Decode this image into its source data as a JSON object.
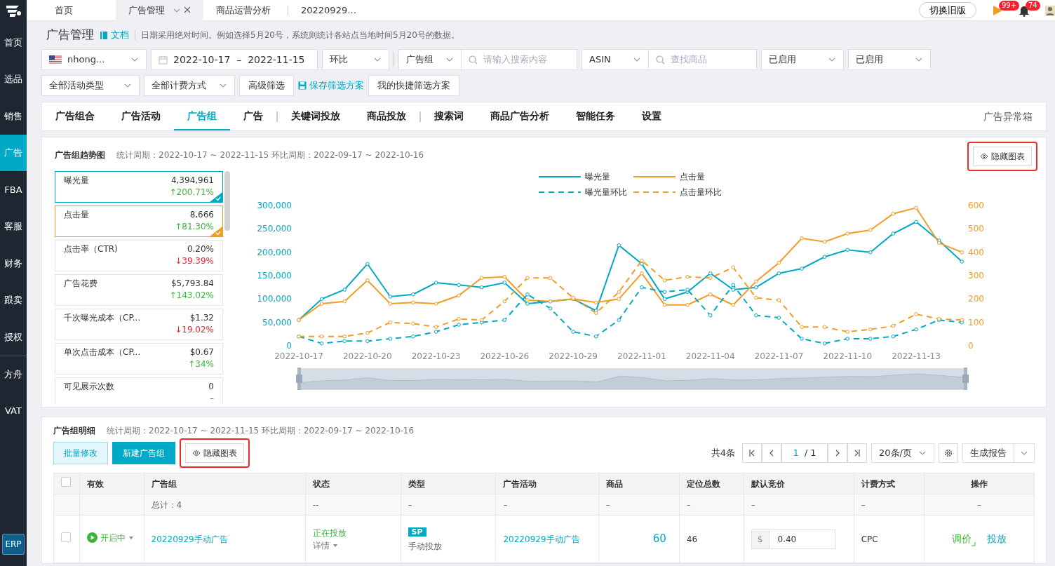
{
  "sidebar": {
    "items": [
      {
        "label": "首页",
        "selected": false,
        "divider_before": false
      },
      {
        "label": "选品",
        "selected": false,
        "divider_before": false
      },
      {
        "label": "销售",
        "selected": false,
        "divider_before": false
      },
      {
        "label": "广告",
        "selected": true,
        "divider_before": false
      },
      {
        "label": "FBA",
        "selected": false,
        "divider_before": false
      },
      {
        "label": "客服",
        "selected": false,
        "divider_before": false
      },
      {
        "label": "财务",
        "selected": false,
        "divider_before": false
      },
      {
        "label": "跟卖",
        "selected": false,
        "divider_before": false
      },
      {
        "label": "授权",
        "selected": false,
        "divider_before": false
      },
      {
        "label": "方舟",
        "selected": false,
        "divider_before": true
      },
      {
        "label": "VAT",
        "selected": false,
        "divider_before": false
      }
    ],
    "footer": "ERP"
  },
  "top_tabs": [
    {
      "label": "首页",
      "selected": false,
      "closable": false
    },
    {
      "label": "广告管理",
      "selected": true,
      "closable": true
    },
    {
      "label": "商品运营分析",
      "selected": false,
      "closable": false
    },
    {
      "label": "20220929…",
      "selected": false,
      "closable": false
    }
  ],
  "header_actions": {
    "switch_button": "切换旧版",
    "flag_badge": "99+",
    "bell_badge": "74"
  },
  "page": {
    "title": "广告管理",
    "doc_link": "文档",
    "note": "日期采用绝对时间。例如选择5月20号，系统则统计各站点当地时间5月20号的数据。"
  },
  "filters": {
    "row1": [
      {
        "kind": "store",
        "value": "nhong..."
      },
      {
        "kind": "daterange",
        "start": "2022-10-17",
        "separator": "–",
        "end": "2022-11-15"
      },
      {
        "kind": "select",
        "value": "环比"
      },
      {
        "kind": "combo",
        "select": "广告组",
        "placeholder": "请输入搜索内容",
        "divider_before": true
      },
      {
        "kind": "combo",
        "select": "ASIN",
        "placeholder": "查找商品",
        "divider_before": false
      },
      {
        "kind": "select",
        "value": "已启用"
      },
      {
        "kind": "select",
        "value": "已启用"
      }
    ],
    "row2": [
      {
        "kind": "select",
        "value": "全部活动类型"
      },
      {
        "kind": "select",
        "value": "全部计费方式"
      },
      {
        "kind": "button",
        "label": "高级筛选"
      },
      {
        "kind": "link",
        "label": "保存筛选方案"
      },
      {
        "kind": "button",
        "label": "我的快捷筛选方案"
      }
    ]
  },
  "nav_tabs": {
    "items": [
      {
        "label": "广告组合",
        "selected": false,
        "divider_after": false
      },
      {
        "label": "广告活动",
        "selected": false,
        "divider_after": false
      },
      {
        "label": "广告组",
        "selected": true,
        "divider_after": false
      },
      {
        "label": "广告",
        "selected": false,
        "divider_after": true
      },
      {
        "label": "关键词投放",
        "selected": false,
        "divider_after": false
      },
      {
        "label": "商品投放",
        "selected": false,
        "divider_after": true
      },
      {
        "label": "搜索词",
        "selected": false,
        "divider_after": false
      },
      {
        "label": "商品广告分析",
        "selected": false,
        "divider_after": false
      },
      {
        "label": "智能任务",
        "selected": false,
        "divider_after": false
      },
      {
        "label": "设置",
        "selected": false,
        "divider_after": false
      }
    ],
    "right_link": "广告异常箱"
  },
  "trend": {
    "title": "广告组趋势图",
    "period": "统计周期：2022-10-17 ~ 2022-11-15 环比周期：2022-09-17 ~ 2022-10-16",
    "hide_button": "隐藏图表",
    "highlighted": true,
    "metrics": [
      {
        "name": "曝光量",
        "value": "4,394,961",
        "change": "↑200.71%",
        "rising": true,
        "selected": true,
        "color": "#00a9c5"
      },
      {
        "name": "点击量",
        "value": "8,666",
        "change": "↑81.30%",
        "rising": true,
        "selected": true,
        "color": "#f39c25"
      },
      {
        "name": "点击率（CTR)",
        "value": "0.20%",
        "change": "↓39.39%",
        "rising": false,
        "selected": false
      },
      {
        "name": "广告花费",
        "value": "$5,793.84",
        "change": "↑143.02%",
        "rising": true,
        "selected": false
      },
      {
        "name": "千次曝光成本（CP...",
        "value": "$1.32",
        "change": "↓19.02%",
        "rising": false,
        "selected": false
      },
      {
        "name": "单次点击成本（CP...",
        "value": "$0.67",
        "change": "↑34%",
        "rising": true,
        "selected": false
      },
      {
        "name": "可见展示次数",
        "value": "0",
        "change": "–",
        "selected": false
      }
    ],
    "chart_data": {
      "type": "line",
      "legend": "top",
      "categories": [
        "2022-10-17",
        null,
        null,
        "2022-10-20",
        null,
        null,
        "2022-10-23",
        null,
        null,
        "2022-10-26",
        null,
        null,
        "2022-10-29",
        null,
        null,
        "2022-11-01",
        null,
        null,
        "2022-11-04",
        null,
        null,
        "2022-11-07",
        null,
        null,
        "2022-11-10",
        null,
        null,
        "2022-11-13",
        null,
        null
      ],
      "series": [
        {
          "name": "曝光量",
          "color": "#00a9c5",
          "line_style": "solid",
          "values": [
            55000,
            100000,
            120000,
            175000,
            105000,
            110000,
            135000,
            130000,
            125000,
            135000,
            90000,
            95000,
            100000,
            75000,
            215000,
            175000,
            100000,
            115000,
            155000,
            120000,
            125000,
            155000,
            165000,
            190000,
            205000,
            200000,
            240000,
            265000,
            225000,
            180000
          ]
        },
        {
          "name": "点击量",
          "color": "#f39c25",
          "axis": "y2",
          "line_style": "solid",
          "values": [
            110,
            180,
            190,
            280,
            180,
            185,
            180,
            215,
            290,
            295,
            195,
            190,
            200,
            185,
            200,
            310,
            175,
            175,
            220,
            175,
            275,
            355,
            460,
            445,
            480,
            495,
            565,
            590,
            440,
            400
          ]
        },
        {
          "name": "曝光量环比",
          "color": "#00a9c5",
          "line_style": "dashed",
          "values": [
            20000,
            5000,
            10000,
            10000,
            15000,
            20000,
            30000,
            45000,
            50000,
            55000,
            110000,
            80000,
            30000,
            20000,
            55000,
            125000,
            115000,
            120000,
            65000,
            130000,
            65000,
            60000,
            15000,
            5000,
            15000,
            15000,
            20000,
            35000,
            55000,
            50000
          ]
        },
        {
          "name": "点击量环比",
          "color": "#f39c25",
          "axis": "y2",
          "line_style": "dashed",
          "values": [
            40,
            40,
            40,
            55,
            100,
            95,
            80,
            115,
            110,
            190,
            290,
            290,
            205,
            140,
            230,
            365,
            280,
            295,
            290,
            335,
            205,
            195,
            80,
            80,
            60,
            70,
            85,
            135,
            115,
            110
          ]
        }
      ],
      "ylim": [
        0,
        300000
      ],
      "yticks": [
        0,
        {
          "value": 50000,
          "label": "50,000"
        },
        {
          "value": 100000,
          "label": "100,000"
        },
        {
          "value": 150000,
          "label": "150,000"
        },
        {
          "value": 200000,
          "label": "200,000"
        },
        {
          "value": 250000,
          "label": "250,000"
        },
        {
          "value": 300000,
          "label": "300,000"
        }
      ],
      "y2lim": [
        0,
        600
      ],
      "y2ticks": [
        0,
        100,
        200,
        300,
        400,
        500,
        600
      ]
    }
  },
  "detail": {
    "title": "广告组明细",
    "period": "统计周期：2022-10-17 ~ 2022-11-15 环比周期：2022-09-17 ~ 2022-10-16",
    "buttons": [
      {
        "label": "批量修改",
        "kind": "light",
        "highlighted": false
      },
      {
        "label": "新建广告组",
        "kind": "primary",
        "highlighted": false
      },
      {
        "label": "隐藏图表",
        "kind": "outline",
        "highlighted": true
      }
    ],
    "total": "共4条",
    "page": "1",
    "pages": "/ 1",
    "page_size": "20条/页",
    "report": "生成报告",
    "select_all": false,
    "columns": [
      "有效",
      "广告组",
      "状态",
      "类型",
      "广告活动",
      "商品",
      "定位总数",
      "默认竞价",
      "计费方式",
      "操作"
    ],
    "total_row": [
      "总计：4",
      "--",
      "–",
      "–",
      "–",
      "–",
      "–",
      "–",
      "–"
    ],
    "rows": [
      {
        "checked": false,
        "enabled": true,
        "status_label": "开启中",
        "name": "20220929手动广告",
        "state": "正在投放",
        "detail": "详情",
        "type_badge": "SP",
        "type": "手动投放",
        "campaign": "20220929手动广告",
        "products": "60",
        "targets": "46",
        "currency": "$",
        "bid": "0.40",
        "billing": "CPC",
        "actions": [
          "调价",
          "投放"
        ]
      }
    ]
  }
}
